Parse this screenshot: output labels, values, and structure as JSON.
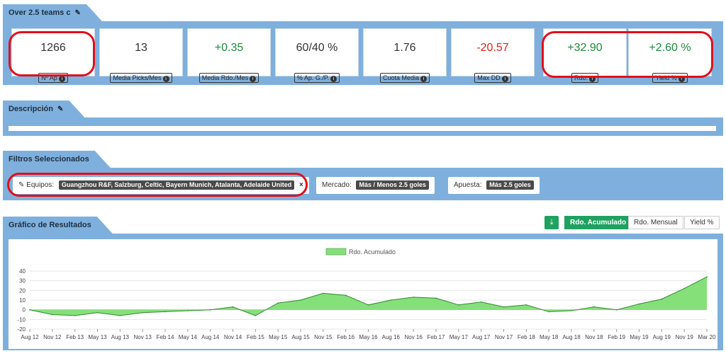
{
  "header": {
    "title": "Over 2.5 teams c",
    "edit_icon": "pencil-icon"
  },
  "stats": [
    {
      "value": "1266",
      "label": "Nº Ap",
      "tone": "neutral"
    },
    {
      "value": "13",
      "label": "Media Picks/Mes",
      "tone": "neutral"
    },
    {
      "value": "+0.35",
      "label": "Media Rdo./Mes",
      "tone": "positive"
    },
    {
      "value": "60/40 %",
      "label": "% Ap. G./P.",
      "tone": "neutral"
    },
    {
      "value": "1.76",
      "label": "Cuota Media",
      "tone": "neutral"
    },
    {
      "value": "-20.57",
      "label": "Max DD",
      "tone": "negative"
    },
    {
      "value": "+32.90",
      "label": "Rdo.",
      "tone": "positive"
    },
    {
      "value": "+2.60 %",
      "label": "Yield %",
      "tone": "positive"
    }
  ],
  "description": {
    "title": "Descripción",
    "text": ""
  },
  "filters": {
    "title": "Filtros Seleccionados",
    "equipos_label": "Equipos:",
    "equipos_value": "Guangzhou R&F, Salzburg, Celtic, Bayern Munich, Atalanta, Adelaide United",
    "remove_symbol": "×",
    "mercado_label": "Mercado:",
    "mercado_value": "Más / Menos 2.5 goles",
    "apuesta_label": "Apuesta:",
    "apuesta_value": "Más 2.5 goles"
  },
  "results": {
    "title": "Gráfico de Resultados",
    "download_icon": "download-icon",
    "buttons": {
      "acumulado": "Rdo. Acumulado",
      "mensual": "Rdo. Mensual",
      "yield": "Yield %"
    }
  },
  "colors": {
    "accent_green": "#1fa160",
    "panel_blue": "#7fb0dd",
    "area_fill": "#86e07a",
    "area_stroke": "#2f8a2f",
    "annotation_red": "#e0101b"
  },
  "chart_data": {
    "type": "area",
    "legend": [
      "Rdo. Acumulado"
    ],
    "legend_position": "top-center",
    "grid": true,
    "ylim": [
      -20,
      40
    ],
    "yticks": [
      -20,
      -10,
      0,
      10,
      20,
      30,
      40
    ],
    "x_labels": [
      "Aug 12",
      "Nov 12",
      "Feb 13",
      "May 13",
      "Aug 13",
      "Nov 13",
      "Feb 14",
      "May 14",
      "Aug 14",
      "Nov 14",
      "Feb 15",
      "May 15",
      "Aug 15",
      "Nov 15",
      "Feb 16",
      "May 16",
      "Aug 16",
      "Nov 16",
      "Feb 17",
      "May 17",
      "Aug 17",
      "Nov 17",
      "Feb 18",
      "May 18",
      "Aug 18",
      "Nov 18",
      "Feb 19",
      "May 19",
      "Aug 19",
      "Nov 19",
      "Mar 20"
    ],
    "series": [
      {
        "name": "Rdo. Acumulado",
        "values": [
          0,
          -5,
          -6,
          -3,
          -6,
          -3,
          -2,
          -1,
          0,
          3,
          -6,
          7,
          10,
          17,
          15,
          5,
          10,
          13,
          12,
          5,
          8,
          3,
          5,
          -2,
          -1,
          3,
          0,
          6,
          11,
          22,
          34
        ]
      }
    ]
  }
}
